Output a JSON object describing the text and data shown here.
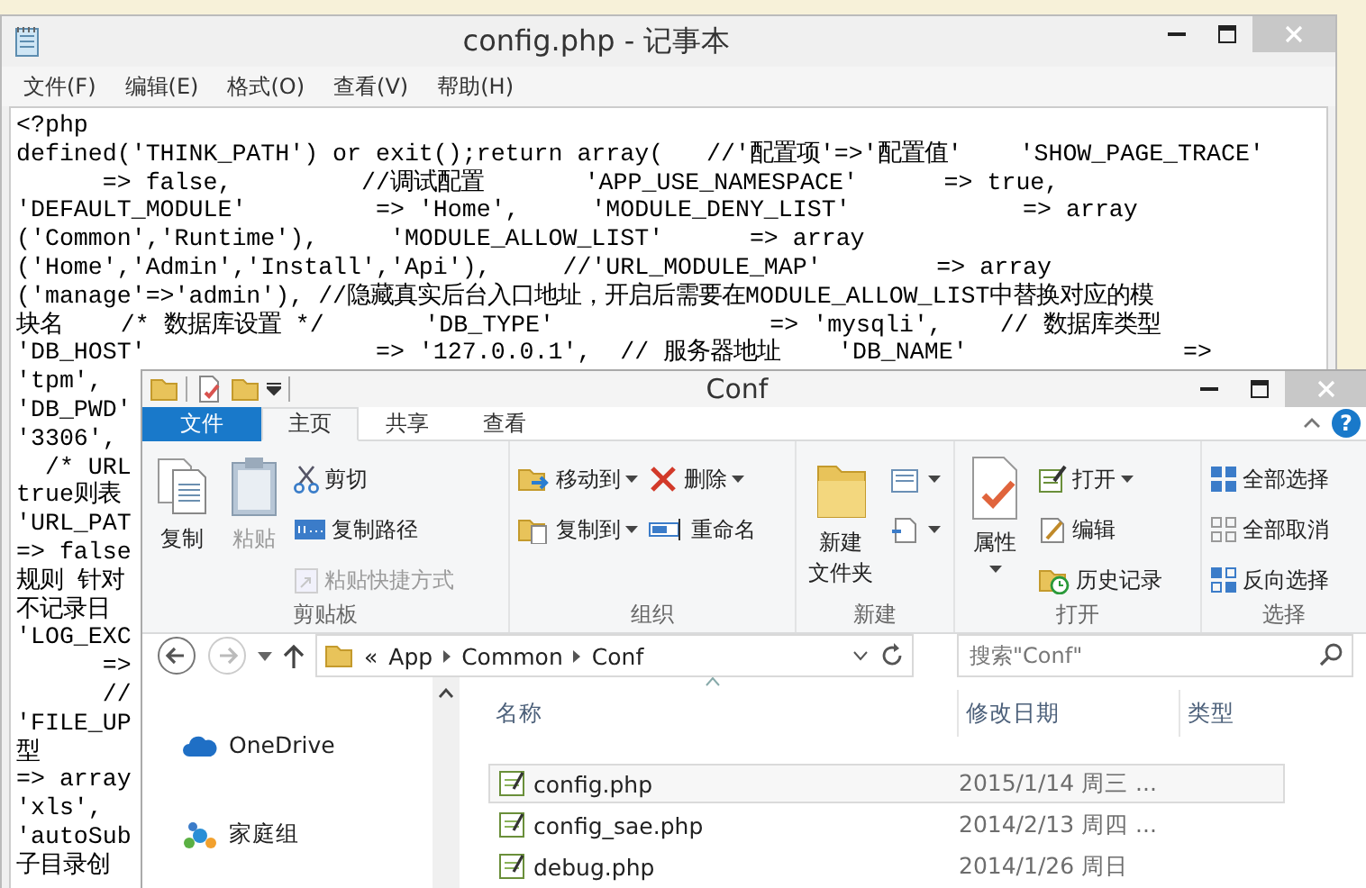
{
  "notepad": {
    "title": "config.php - 记事本",
    "menu": [
      "文件(F)",
      "编辑(E)",
      "格式(O)",
      "查看(V)",
      "帮助(H)"
    ],
    "lines": [
      "<?php",
      "defined('THINK_PATH') or exit();return array(   //'配置项'=>'配置值'    'SHOW_PAGE_TRACE'",
      "      => false,         //调试配置       'APP_USE_NAMESPACE'      => true,",
      "'DEFAULT_MODULE'         => 'Home',     'MODULE_DENY_LIST'            => array",
      "('Common','Runtime'),     'MODULE_ALLOW_LIST'      => array",
      "('Home','Admin','Install','Api'),     //'URL_MODULE_MAP'        => array",
      "('manage'=>'admin'), //隐藏真实后台入口地址，开启后需要在MODULE_ALLOW_LIST中替换对应的模",
      "块名    /* 数据库设置 */       'DB_TYPE'               => 'mysqli',    // 数据库类型",
      "'DB_HOST'                => '127.0.0.1',  // 服务器地址    'DB_NAME'               =>",
      "'tpm',",
      "'DB_PWD'",
      "'3306',",
      "  /* URL",
      "true则表",
      "'URL_PAT",
      "=> false",
      "规则 针对",
      "不记录日",
      "'LOG_EXC",
      "      =>",
      "      //",
      "'FILE_UP",
      "型",
      "=> array",
      "'xls',",
      "'autoSub",
      "子目录创"
    ]
  },
  "explorer": {
    "title": "Conf",
    "tabs": [
      {
        "label": "文件",
        "kind": "file",
        "selected": false
      },
      {
        "label": "主页",
        "kind": "tab",
        "selected": true
      },
      {
        "label": "共享",
        "kind": "tab",
        "selected": false
      },
      {
        "label": "查看",
        "kind": "tab",
        "selected": false
      }
    ],
    "help": "?",
    "ribbon_groups": [
      {
        "label": "剪贴板",
        "items": [
          {
            "kind": "large",
            "label": "复制",
            "disabled": false,
            "dropdown": false
          },
          {
            "kind": "large",
            "label": "粘贴",
            "disabled": true,
            "dropdown": false
          },
          {
            "kind": "small",
            "label": "剪切",
            "disabled": false,
            "dropdown": false
          },
          {
            "kind": "small",
            "label": "复制路径",
            "disabled": false,
            "dropdown": false
          },
          {
            "kind": "small",
            "label": "粘贴快捷方式",
            "disabled": true,
            "dropdown": false
          }
        ]
      },
      {
        "label": "组织",
        "items": [
          {
            "kind": "small",
            "label": "移动到",
            "disabled": false,
            "dropdown": true
          },
          {
            "kind": "small",
            "label": "复制到",
            "disabled": false,
            "dropdown": true
          },
          {
            "kind": "small",
            "label": "删除",
            "disabled": false,
            "dropdown": true
          },
          {
            "kind": "small",
            "label": "重命名",
            "disabled": false,
            "dropdown": false
          }
        ]
      },
      {
        "label": "新建",
        "items": [
          {
            "kind": "large",
            "label": "新建文件夹",
            "disabled": false,
            "dropdown": false
          },
          {
            "kind": "small",
            "disabled": false,
            "dropdown": true
          },
          {
            "kind": "small",
            "disabled": false,
            "dropdown": true
          }
        ]
      },
      {
        "label": "打开",
        "items": [
          {
            "kind": "large",
            "label": "属性",
            "disabled": false,
            "dropdown": true
          },
          {
            "kind": "small",
            "label": "打开",
            "disabled": false,
            "dropdown": true
          },
          {
            "kind": "small",
            "label": "编辑",
            "disabled": false,
            "dropdown": false
          },
          {
            "kind": "small",
            "label": "历史记录",
            "disabled": false,
            "dropdown": false
          }
        ]
      },
      {
        "label": "选择",
        "items": [
          {
            "kind": "small",
            "label": "全部选择",
            "disabled": false,
            "dropdown": false
          },
          {
            "kind": "small",
            "label": "全部取消",
            "disabled": false,
            "dropdown": false
          },
          {
            "kind": "small",
            "label": "反向选择",
            "disabled": false,
            "dropdown": false
          }
        ]
      }
    ],
    "address": {
      "prefix": "«",
      "crumbs": [
        "App",
        "Common",
        "Conf"
      ]
    },
    "search": {
      "placeholder": "搜索\"Conf\""
    },
    "nav_pane": [
      "OneDrive",
      "家庭组"
    ],
    "columns": [
      "名称",
      "修改日期",
      "类型"
    ],
    "rows": [
      {
        "name": "config.php",
        "date": "2015/1/14 周三 ...",
        "selected": true
      },
      {
        "name": "config_sae.php",
        "date": "2014/2/13 周四 ...",
        "selected": false
      },
      {
        "name": "debug.php",
        "date": "2014/1/26 周日",
        "selected": false
      }
    ]
  }
}
